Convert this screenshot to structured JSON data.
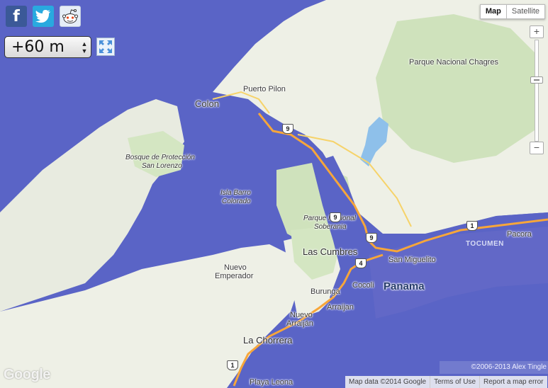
{
  "social": {
    "facebook_glyph": "f"
  },
  "sea_level": {
    "selected": "+60 m"
  },
  "map_type": {
    "map": "Map",
    "satellite": "Satellite",
    "active": "Map"
  },
  "zoom": {
    "in": "+",
    "out": "−",
    "mid_mark": "−"
  },
  "labels": {
    "parque_chagres": "Parque Nacional Chagres",
    "puerto_pilon": "Puerto Pilon",
    "colon": "Colon",
    "bosque_1": "Bosque de Protección",
    "bosque_2": "San Lorenzo",
    "isla_1": "Isla Barro",
    "isla_2": "Colorado",
    "soberania_1": "Parque Nacional",
    "soberania_2": "Soberania",
    "las_cumbres": "Las Cumbres",
    "san_miguelito": "San Miguelito",
    "pacora": "Pacora",
    "tocumen": "TOCUMEN",
    "nuevo_emp_1": "Nuevo",
    "nuevo_emp_2": "Emperador",
    "burunga": "Burunga",
    "cocoli": "Cocoli",
    "panama": "Panama",
    "arraijan": "Arraijan",
    "nuevo_arr_1": "Nuevo",
    "nuevo_arr_2": "Arraiján",
    "la_chorrera": "La Chorrera",
    "playa_leona": "Playa Leona"
  },
  "shields": {
    "r9a": "9",
    "r9b": "9",
    "r9c": "9",
    "r4": "4",
    "r1": "1",
    "r1b": "1"
  },
  "footer": {
    "tingle": "©2006-2013 Alex Tingle",
    "map_data": "Map data ©2014 Google",
    "terms": "Terms of Use",
    "report": "Report a map error",
    "google_logo": "Google"
  },
  "colors": {
    "flood": "#5a64c6",
    "land": "#eef0e6",
    "park": "#cfe2bc",
    "road_major": "#f7a63a",
    "road_minor": "#f6d36a",
    "water": "#8ec0ea"
  }
}
